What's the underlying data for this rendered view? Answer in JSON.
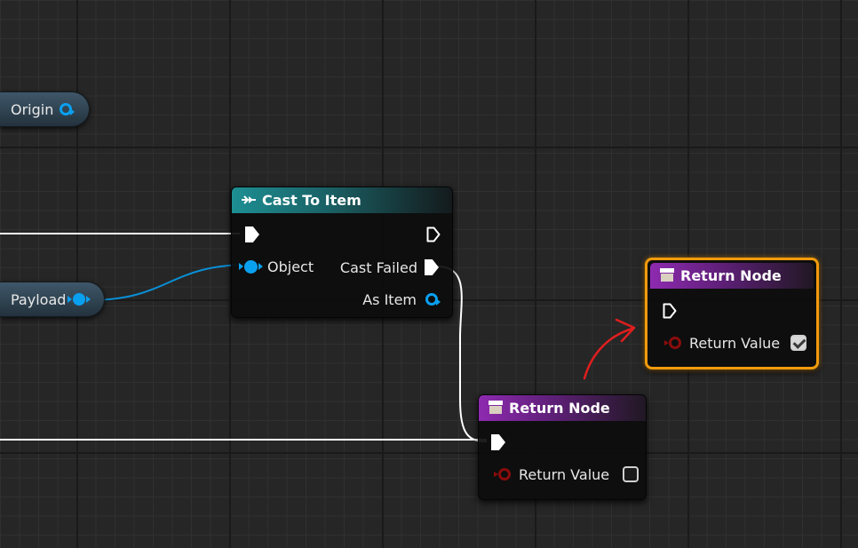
{
  "variables": {
    "origin": {
      "label": "Origin"
    },
    "payload": {
      "label": "Payload"
    }
  },
  "cast_node": {
    "title": "Cast To Item",
    "icon": "cast-arrow-icon",
    "inputs": {
      "object_label": "Object"
    },
    "outputs": {
      "cast_failed_label": "Cast Failed",
      "as_item_label": "As Item"
    }
  },
  "return_node_lower": {
    "title": "Return Node",
    "icon": "return-node-icon",
    "return_value_label": "Return Value",
    "return_value_checked": false
  },
  "return_node_selected": {
    "title": "Return Node",
    "icon": "return-node-icon",
    "return_value_label": "Return Value",
    "return_value_checked": true,
    "selection_color": "#f29b0c"
  },
  "annotation": {
    "type": "red-arrow",
    "color": "#e01e1e"
  },
  "colors": {
    "object_pin": "#0aa0f0",
    "bool_pin": "#8a0c0c",
    "exec_wire": "#ffffff",
    "cast_header": "#1d8f93",
    "return_header": "#8e2ab0"
  }
}
